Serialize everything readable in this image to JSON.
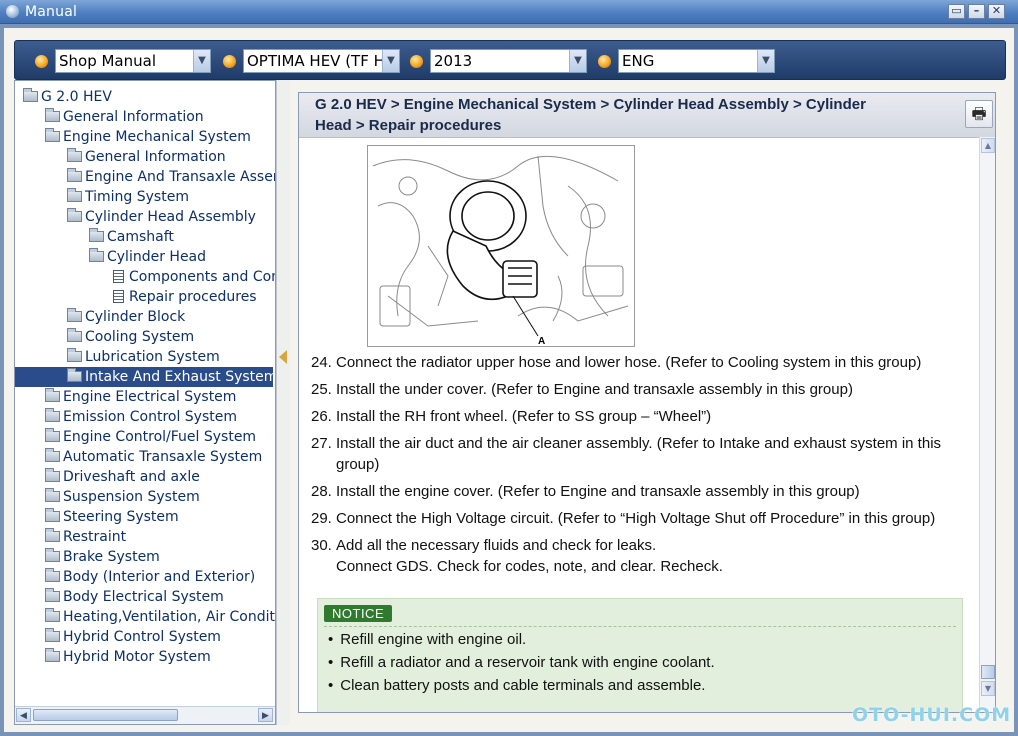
{
  "window": {
    "title": "Manual",
    "controls": {
      "restore": "▭",
      "minimize": "–",
      "close": "✕"
    }
  },
  "toolbar": {
    "selectors": [
      {
        "name": "manual-type-select",
        "value": "Shop Manual"
      },
      {
        "name": "model-select",
        "value": "OPTIMA HEV (TF HEV)"
      },
      {
        "name": "year-select",
        "value": "2013"
      },
      {
        "name": "language-select",
        "value": "ENG"
      }
    ],
    "arrow": "▼"
  },
  "tree": {
    "items": [
      {
        "label": "G 2.0 HEV",
        "type": "folder-open"
      },
      {
        "label": "General Information",
        "type": "folder"
      },
      {
        "label": "Engine Mechanical System",
        "type": "folder-open"
      },
      {
        "label": "General Information",
        "type": "folder"
      },
      {
        "label": "Engine And Transaxle Assembly",
        "type": "folder"
      },
      {
        "label": "Timing System",
        "type": "folder"
      },
      {
        "label": "Cylinder Head Assembly",
        "type": "folder-open"
      },
      {
        "label": "Camshaft",
        "type": "folder"
      },
      {
        "label": "Cylinder Head",
        "type": "folder-open"
      },
      {
        "label": "Components and Components Location",
        "type": "doc"
      },
      {
        "label": "Repair procedures",
        "type": "doc"
      },
      {
        "label": "Cylinder Block",
        "type": "folder"
      },
      {
        "label": "Cooling System",
        "type": "folder"
      },
      {
        "label": "Lubrication System",
        "type": "folder"
      },
      {
        "label": "Intake And Exhaust System",
        "type": "folder",
        "selected": true
      },
      {
        "label": "Engine Electrical System",
        "type": "folder"
      },
      {
        "label": "Emission Control System",
        "type": "folder"
      },
      {
        "label": "Engine Control/Fuel System",
        "type": "folder"
      },
      {
        "label": "Automatic Transaxle System",
        "type": "folder"
      },
      {
        "label": "Driveshaft and axle",
        "type": "folder"
      },
      {
        "label": "Suspension System",
        "type": "folder"
      },
      {
        "label": "Steering System",
        "type": "folder"
      },
      {
        "label": "Restraint",
        "type": "folder"
      },
      {
        "label": "Brake System",
        "type": "folder"
      },
      {
        "label": "Body (Interior and Exterior)",
        "type": "folder"
      },
      {
        "label": "Body Electrical System",
        "type": "folder"
      },
      {
        "label": "Heating,Ventilation, Air Conditioning",
        "type": "folder"
      },
      {
        "label": "Hybrid Control System",
        "type": "folder"
      },
      {
        "label": "Hybrid Motor System",
        "type": "folder"
      }
    ]
  },
  "content": {
    "breadcrumb_line1": "G 2.0 HEV > Engine Mechanical System > Cylinder Head Assembly > Cylinder",
    "breadcrumb_line2": "Head > Repair procedures",
    "print_icon": "🖶",
    "figure_label": "A",
    "steps": [
      {
        "num": "24.",
        "text": "Connect the radiator upper hose and lower hose. (Refer to Cooling system in this group)"
      },
      {
        "num": "25.",
        "text": "Install the under cover. (Refer to Engine and transaxle assembly in this group)"
      },
      {
        "num": "26.",
        "text": "Install the RH front wheel. (Refer to SS group – “Wheel”)"
      },
      {
        "num": "27.",
        "text": "Install the air duct and the air cleaner assembly. (Refer to Intake and exhaust system in this group)"
      },
      {
        "num": "28.",
        "text": "Install the engine cover. (Refer to Engine and transaxle assembly in this group)"
      },
      {
        "num": "29.",
        "text": "Connect the High Voltage circuit. (Refer to “High Voltage Shut off Procedure” in this group)"
      },
      {
        "num": "30.",
        "text": "Add all the necessary fluids and check for leaks.",
        "text2": "Connect GDS. Check for codes, note, and clear. Recheck."
      }
    ],
    "notice": {
      "label": "NOTICE",
      "items": [
        "Refill engine with engine oil.",
        "Refill a radiator and a reservoir tank with engine coolant.",
        "Clean battery posts and cable terminals and assemble."
      ]
    }
  },
  "watermark": "OTO-HUI.COM"
}
